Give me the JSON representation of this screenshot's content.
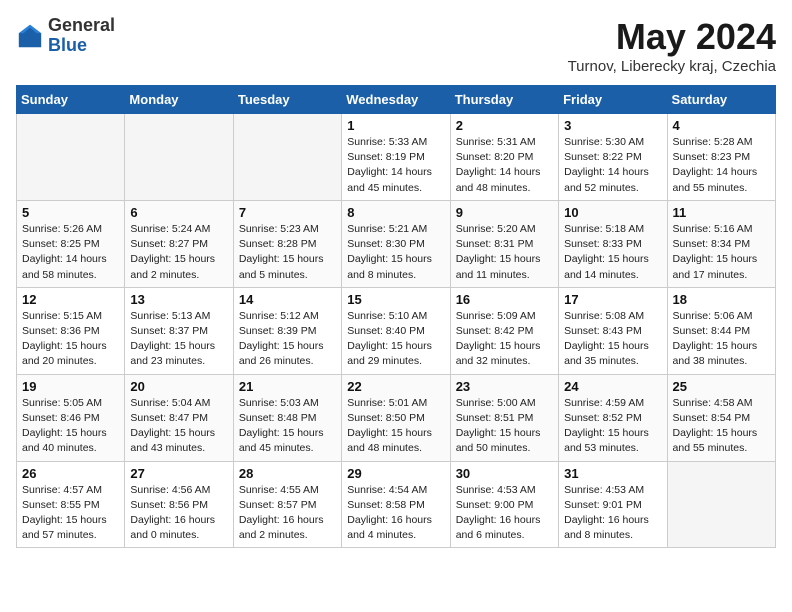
{
  "header": {
    "logo_general": "General",
    "logo_blue": "Blue",
    "month_year": "May 2024",
    "location": "Turnov, Liberecky kraj, Czechia"
  },
  "weekdays": [
    "Sunday",
    "Monday",
    "Tuesday",
    "Wednesday",
    "Thursday",
    "Friday",
    "Saturday"
  ],
  "weeks": [
    [
      {
        "day": "",
        "info": ""
      },
      {
        "day": "",
        "info": ""
      },
      {
        "day": "",
        "info": ""
      },
      {
        "day": "1",
        "info": "Sunrise: 5:33 AM\nSunset: 8:19 PM\nDaylight: 14 hours and 45 minutes."
      },
      {
        "day": "2",
        "info": "Sunrise: 5:31 AM\nSunset: 8:20 PM\nDaylight: 14 hours and 48 minutes."
      },
      {
        "day": "3",
        "info": "Sunrise: 5:30 AM\nSunset: 8:22 PM\nDaylight: 14 hours and 52 minutes."
      },
      {
        "day": "4",
        "info": "Sunrise: 5:28 AM\nSunset: 8:23 PM\nDaylight: 14 hours and 55 minutes."
      }
    ],
    [
      {
        "day": "5",
        "info": "Sunrise: 5:26 AM\nSunset: 8:25 PM\nDaylight: 14 hours and 58 minutes."
      },
      {
        "day": "6",
        "info": "Sunrise: 5:24 AM\nSunset: 8:27 PM\nDaylight: 15 hours and 2 minutes."
      },
      {
        "day": "7",
        "info": "Sunrise: 5:23 AM\nSunset: 8:28 PM\nDaylight: 15 hours and 5 minutes."
      },
      {
        "day": "8",
        "info": "Sunrise: 5:21 AM\nSunset: 8:30 PM\nDaylight: 15 hours and 8 minutes."
      },
      {
        "day": "9",
        "info": "Sunrise: 5:20 AM\nSunset: 8:31 PM\nDaylight: 15 hours and 11 minutes."
      },
      {
        "day": "10",
        "info": "Sunrise: 5:18 AM\nSunset: 8:33 PM\nDaylight: 15 hours and 14 minutes."
      },
      {
        "day": "11",
        "info": "Sunrise: 5:16 AM\nSunset: 8:34 PM\nDaylight: 15 hours and 17 minutes."
      }
    ],
    [
      {
        "day": "12",
        "info": "Sunrise: 5:15 AM\nSunset: 8:36 PM\nDaylight: 15 hours and 20 minutes."
      },
      {
        "day": "13",
        "info": "Sunrise: 5:13 AM\nSunset: 8:37 PM\nDaylight: 15 hours and 23 minutes."
      },
      {
        "day": "14",
        "info": "Sunrise: 5:12 AM\nSunset: 8:39 PM\nDaylight: 15 hours and 26 minutes."
      },
      {
        "day": "15",
        "info": "Sunrise: 5:10 AM\nSunset: 8:40 PM\nDaylight: 15 hours and 29 minutes."
      },
      {
        "day": "16",
        "info": "Sunrise: 5:09 AM\nSunset: 8:42 PM\nDaylight: 15 hours and 32 minutes."
      },
      {
        "day": "17",
        "info": "Sunrise: 5:08 AM\nSunset: 8:43 PM\nDaylight: 15 hours and 35 minutes."
      },
      {
        "day": "18",
        "info": "Sunrise: 5:06 AM\nSunset: 8:44 PM\nDaylight: 15 hours and 38 minutes."
      }
    ],
    [
      {
        "day": "19",
        "info": "Sunrise: 5:05 AM\nSunset: 8:46 PM\nDaylight: 15 hours and 40 minutes."
      },
      {
        "day": "20",
        "info": "Sunrise: 5:04 AM\nSunset: 8:47 PM\nDaylight: 15 hours and 43 minutes."
      },
      {
        "day": "21",
        "info": "Sunrise: 5:03 AM\nSunset: 8:48 PM\nDaylight: 15 hours and 45 minutes."
      },
      {
        "day": "22",
        "info": "Sunrise: 5:01 AM\nSunset: 8:50 PM\nDaylight: 15 hours and 48 minutes."
      },
      {
        "day": "23",
        "info": "Sunrise: 5:00 AM\nSunset: 8:51 PM\nDaylight: 15 hours and 50 minutes."
      },
      {
        "day": "24",
        "info": "Sunrise: 4:59 AM\nSunset: 8:52 PM\nDaylight: 15 hours and 53 minutes."
      },
      {
        "day": "25",
        "info": "Sunrise: 4:58 AM\nSunset: 8:54 PM\nDaylight: 15 hours and 55 minutes."
      }
    ],
    [
      {
        "day": "26",
        "info": "Sunrise: 4:57 AM\nSunset: 8:55 PM\nDaylight: 15 hours and 57 minutes."
      },
      {
        "day": "27",
        "info": "Sunrise: 4:56 AM\nSunset: 8:56 PM\nDaylight: 16 hours and 0 minutes."
      },
      {
        "day": "28",
        "info": "Sunrise: 4:55 AM\nSunset: 8:57 PM\nDaylight: 16 hours and 2 minutes."
      },
      {
        "day": "29",
        "info": "Sunrise: 4:54 AM\nSunset: 8:58 PM\nDaylight: 16 hours and 4 minutes."
      },
      {
        "day": "30",
        "info": "Sunrise: 4:53 AM\nSunset: 9:00 PM\nDaylight: 16 hours and 6 minutes."
      },
      {
        "day": "31",
        "info": "Sunrise: 4:53 AM\nSunset: 9:01 PM\nDaylight: 16 hours and 8 minutes."
      },
      {
        "day": "",
        "info": ""
      }
    ]
  ]
}
